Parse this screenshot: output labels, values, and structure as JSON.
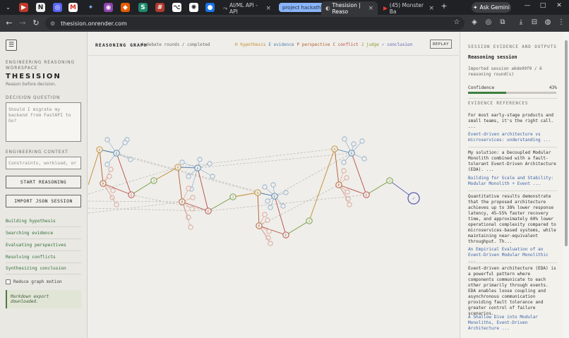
{
  "browser": {
    "tabs": [
      {
        "icon": "youtube-icon",
        "title": "AI/ML API - API",
        "color": "#ff0000"
      },
      {
        "icon": "browser-tab-icon",
        "title": "Thesision | Reaso",
        "color": "#5f6368"
      },
      {
        "icon": "youtube-icon",
        "title": "(45) Monster Ba",
        "color": "#ff0000"
      }
    ],
    "tab_group": "project hackathon",
    "ask_gemini": "Ask Gemini",
    "url": "thesision.onrender.com"
  },
  "sidebar": {
    "workspace_label": "ENGINEERING REASONING\nWORKSPACE",
    "app_title": "THESISION",
    "tagline": "Reason before decision.",
    "question_label": "DECISION QUESTION",
    "question_value": "Should I migrate my\nbackend from FastAPI to\nGo?",
    "context_label": "ENGINEERING CONTEXT",
    "context_placeholder": "Constraints, workload, or",
    "start_button": "START REASONING",
    "import_button": "IMPORT JSON SESSION",
    "stages": [
      "Building hypothesis",
      "Searching evidence",
      "Evaluating perspectives",
      "Resolving conflicts",
      "Synthesizing conclusion"
    ],
    "reduce_motion": "Reduce graph motion",
    "toast": "Markdown export downloaded."
  },
  "graph": {
    "title": "REASONING GRAPH",
    "status": "6 debate rounds / completed",
    "legend": [
      {
        "key": "H",
        "label": "hypothesis",
        "color": "#c08a2c"
      },
      {
        "key": "E",
        "label": "evidence",
        "color": "#4e7fb0"
      },
      {
        "key": "P",
        "label": "perspective",
        "color": "#b35a2a"
      },
      {
        "key": "C",
        "label": "conflict",
        "color": "#b8493f"
      },
      {
        "key": "J",
        "label": "judge",
        "color": "#8b9a2e"
      },
      {
        "key": "✓",
        "label": "conclusion",
        "color": "#5a5fb4"
      }
    ],
    "replay": "REPLAY",
    "node_colors": {
      "H": "#c08a2c",
      "E": "#4e7fb0",
      "P": "#b35a2a",
      "C": "#b8493f",
      "J": "#6f9a3a",
      "V": "#5a5fb4",
      "leaf_e": "#88a6c8",
      "leaf_p": "#d79a8a"
    }
  },
  "right": {
    "section_label": "SESSION EVIDENCE AND OUTPUTS",
    "title": "Reasoning session",
    "imported": "Imported session a6de90f0 / 6 reasoning round(s)",
    "confidence_label": "Confidence",
    "confidence_value": "43%",
    "confidence_fraction": 0.43,
    "evidence_label": "EVIDENCE REFERENCES",
    "evidence": [
      {
        "text": "For most early-stage products and small teams, it's the right call. ...",
        "link": "Event-driven architecture vs microservices: understanding ..."
      },
      {
        "text": "My solution: a Decoupled Modular Monolith combined with a fault-tolerant Event-Driven Architecture (EDA). ...",
        "link": "Building for Scale and Stability: Modular Monolith + Event ..."
      },
      {
        "text": "Quantitative results demonstrate that the proposed architecture achieves up to 38% lower response latency, 45–55% faster recovery time, and approximately 60% lower operational complexity compared to microservices-based systems, while maintaining near-equivalent throughput. Th...",
        "link": "An Empirical Evaluation of an Event-Driven Modular Monolithic ..."
      },
      {
        "text": "Event-driven architecture (EDA) is a powerful pattern where components communicate to each other primarily through events. EDA enables loose coupling and asynchronous communication providing fault tolerance and greater control of failure scenarios.",
        "link": "A Shallow Dive into Modular Monoliths, Event-Driven Architecture ..."
      }
    ]
  }
}
